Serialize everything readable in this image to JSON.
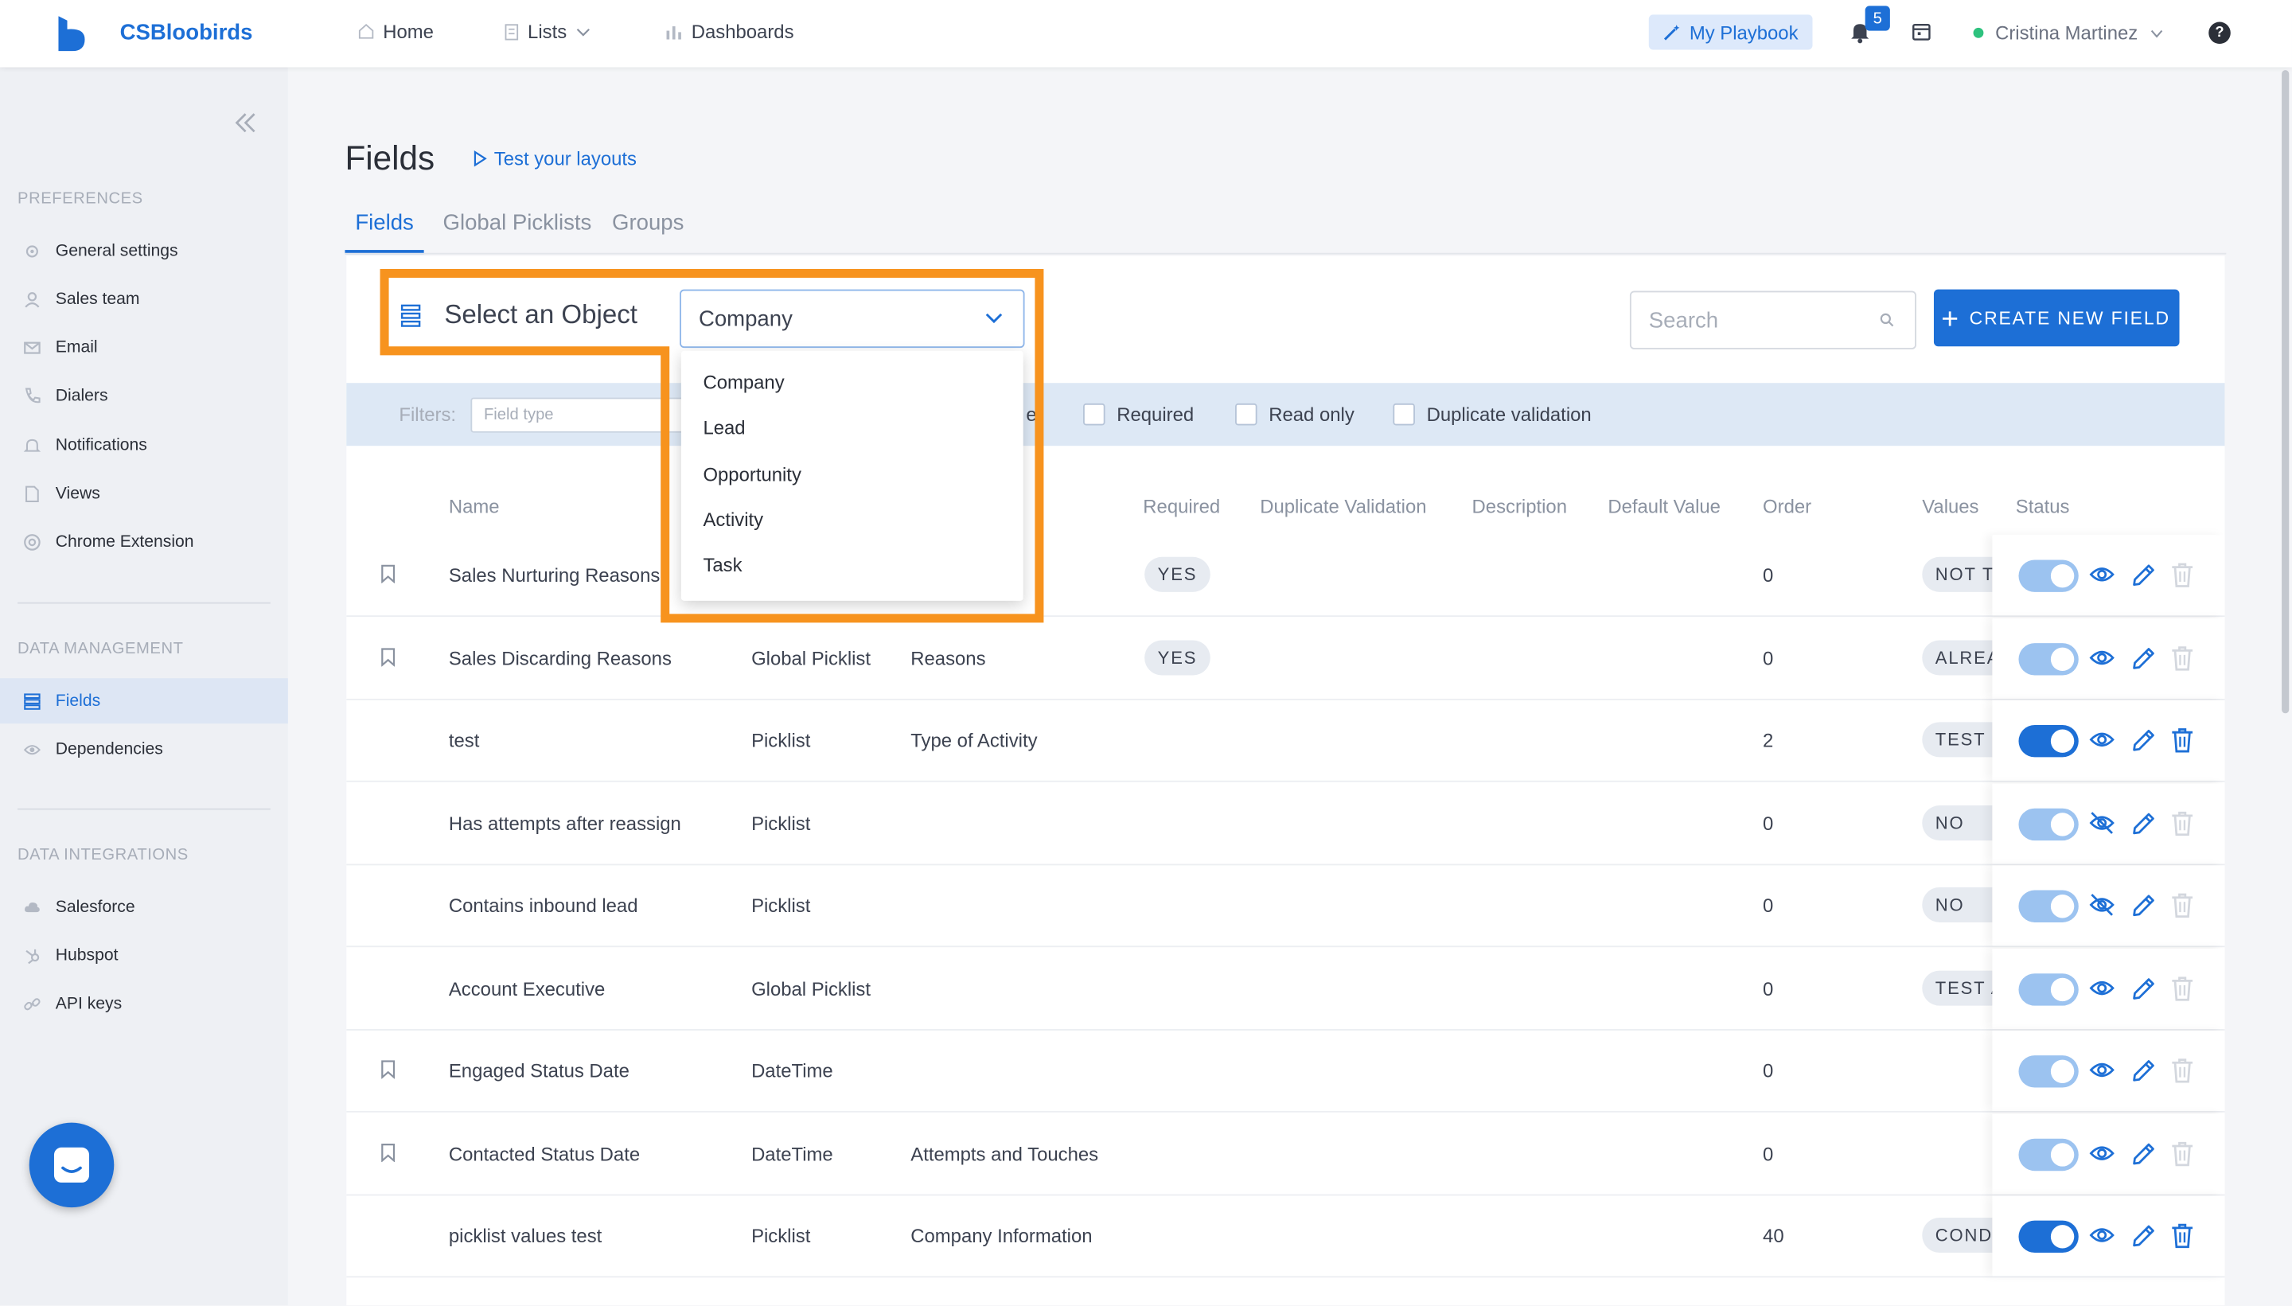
{
  "app": {
    "brand": "CSBloobirds"
  },
  "topnav": {
    "home": "Home",
    "lists": "Lists",
    "dashboards": "Dashboards"
  },
  "header": {
    "playbook": "My Playbook",
    "notifications_count": "5",
    "user_name": "Cristina Martinez",
    "help": "?"
  },
  "sidebar": {
    "preferences_title": "PREFERENCES",
    "preferences": [
      {
        "label": "General settings",
        "icon": "gear-icon"
      },
      {
        "label": "Sales team",
        "icon": "user-icon"
      },
      {
        "label": "Email",
        "icon": "mail-icon"
      },
      {
        "label": "Dialers",
        "icon": "phone-icon"
      },
      {
        "label": "Notifications",
        "icon": "bell-icon"
      },
      {
        "label": "Views",
        "icon": "document-icon"
      },
      {
        "label": "Chrome Extension",
        "icon": "chrome-icon"
      }
    ],
    "data_management_title": "DATA MANAGEMENT",
    "data_management": [
      {
        "label": "Fields",
        "icon": "list-icon",
        "active": true
      },
      {
        "label": "Dependencies",
        "icon": "eye-icon"
      }
    ],
    "data_integrations_title": "DATA INTEGRATIONS",
    "data_integrations": [
      {
        "label": "Salesforce",
        "icon": "cloud-icon"
      },
      {
        "label": "Hubspot",
        "icon": "hubspot-icon"
      },
      {
        "label": "API keys",
        "icon": "link-icon"
      }
    ]
  },
  "page": {
    "title": "Fields",
    "test_layouts": "Test your layouts",
    "tabs": [
      "Fields",
      "Global Picklists",
      "Groups"
    ],
    "select_label": "Select an Object",
    "selected_object": "Company",
    "search_placeholder": "Search",
    "create_button": "CREATE NEW FIELD"
  },
  "dropdown": {
    "options": [
      "Company",
      "Lead",
      "Opportunity",
      "Activity",
      "Task"
    ]
  },
  "filters": {
    "label": "Filters:",
    "field_type_placeholder": "Field type",
    "clipped_label": "el",
    "checkboxes": [
      "Required",
      "Read only",
      "Duplicate validation"
    ]
  },
  "table": {
    "columns": [
      "Name",
      "Required",
      "Duplicate Validation",
      "Description",
      "Default Value",
      "Order",
      "Values",
      "Status"
    ],
    "rows": [
      {
        "bookmark": true,
        "name": "Sales Nurturing Reasons",
        "type": "",
        "group": "",
        "required": "YES",
        "order": "0",
        "values": "NOT TOUCHED",
        "enabled": false,
        "visible": true,
        "deletable": false
      },
      {
        "bookmark": true,
        "name": "Sales Discarding Reasons",
        "type": "Global Picklist",
        "group": "Reasons",
        "required": "YES",
        "order": "0",
        "values": "ALREADY",
        "enabled": false,
        "visible": true,
        "deletable": false
      },
      {
        "bookmark": false,
        "name": "test",
        "type": "Picklist",
        "group": "Type of Activity",
        "required": "",
        "order": "2",
        "values": "TEST",
        "enabled": true,
        "visible": true,
        "deletable": true
      },
      {
        "bookmark": false,
        "name": "Has attempts after reassign",
        "type": "Picklist",
        "group": "",
        "required": "",
        "order": "0",
        "values": "NO",
        "enabled": false,
        "visible": false,
        "deletable": false
      },
      {
        "bookmark": false,
        "name": "Contains inbound lead",
        "type": "Picklist",
        "group": "",
        "required": "",
        "order": "0",
        "values": "NO",
        "enabled": false,
        "visible": false,
        "deletable": false
      },
      {
        "bookmark": false,
        "name": "Account Executive",
        "type": "Global Picklist",
        "group": "",
        "required": "",
        "order": "0",
        "values": "TEST A",
        "enabled": false,
        "visible": true,
        "deletable": false
      },
      {
        "bookmark": true,
        "name": "Engaged Status Date",
        "type": "DateTime",
        "group": "",
        "required": "",
        "order": "0",
        "values": "",
        "enabled": false,
        "visible": true,
        "deletable": false
      },
      {
        "bookmark": true,
        "name": "Contacted Status Date",
        "type": "DateTime",
        "group": "Attempts and Touches",
        "required": "",
        "order": "0",
        "values": "",
        "enabled": false,
        "visible": true,
        "deletable": false
      },
      {
        "bookmark": false,
        "name": "picklist values test",
        "type": "Picklist",
        "group": "Company Information",
        "required": "",
        "order": "40",
        "values": "COND",
        "enabled": true,
        "visible": true,
        "deletable": true
      }
    ]
  },
  "colors": {
    "brand": "#1d6fd6",
    "highlight": "#f7931e",
    "toggle_off": "#9cc3f0"
  }
}
